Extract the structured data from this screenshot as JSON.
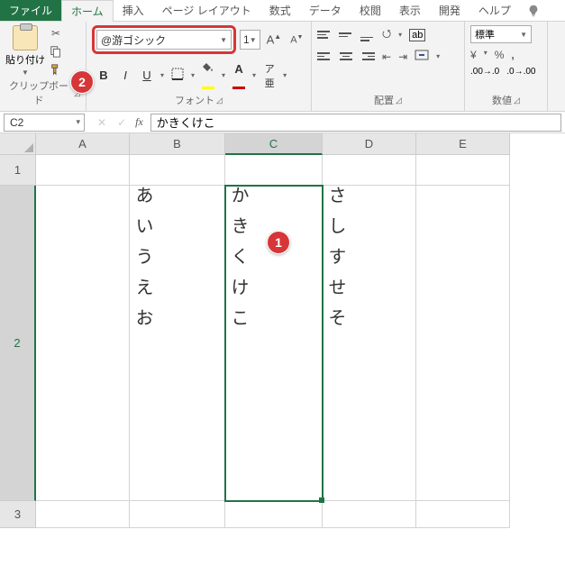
{
  "tabs": {
    "file": "ファイル",
    "home": "ホーム",
    "insert": "挿入",
    "page_layout": "ページ レイアウト",
    "formulas": "数式",
    "data": "データ",
    "review": "校閲",
    "view": "表示",
    "developer": "開発",
    "help": "ヘルプ"
  },
  "ribbon": {
    "clipboard": {
      "paste": "貼り付け",
      "label": "クリップボード"
    },
    "font": {
      "name": "@游ゴシック",
      "size": "1",
      "label": "フォント"
    },
    "alignment": {
      "label": "配置"
    },
    "number": {
      "format": "標準",
      "label": "数値"
    }
  },
  "namebox": "C2",
  "formula_bar": "かきくけこ",
  "columns": [
    "A",
    "B",
    "C",
    "D",
    "E"
  ],
  "rows": [
    "1",
    "2",
    "3"
  ],
  "cells": {
    "B2": "あいうえお",
    "C2": "かきくけこ",
    "D2": "さしすせそ"
  },
  "selected_cell": "C2",
  "badges": {
    "b1": "1",
    "b2": "2"
  }
}
